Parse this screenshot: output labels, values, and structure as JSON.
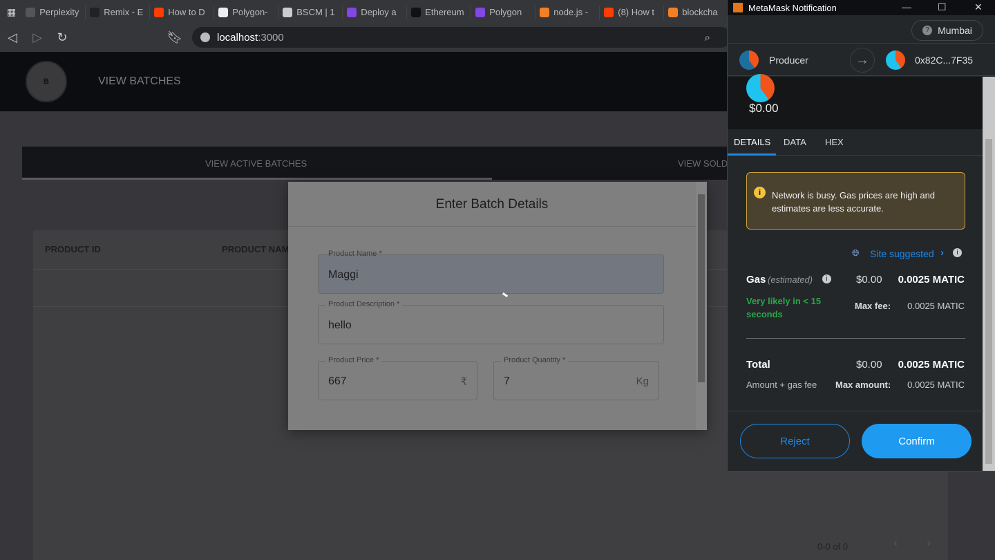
{
  "browser": {
    "tabs": [
      {
        "label": "Perplexity",
        "color": "#555"
      },
      {
        "label": "Remix - E",
        "color": "#222"
      },
      {
        "label": "How to D",
        "color": "#ff3d00"
      },
      {
        "label": "Polygon-",
        "color": "#eee"
      },
      {
        "label": "BSCM | 1",
        "color": "#ccc"
      },
      {
        "label": "Deploy a",
        "color": "#8247e5"
      },
      {
        "label": "Ethereum",
        "color": "#111"
      },
      {
        "label": "Polygon",
        "color": "#8247e5"
      },
      {
        "label": "node.js -",
        "color": "#f48024"
      },
      {
        "label": "(8) How t",
        "color": "#ff3d00"
      },
      {
        "label": "blockcha",
        "color": "#f48024"
      }
    ],
    "url_host": "localhost",
    "url_port": ":3000"
  },
  "app": {
    "logo_text": "B",
    "nav_link": "VIEW BATCHES",
    "tabs": [
      "VIEW ACTIVE BATCHES",
      "VIEW SOLD"
    ],
    "columns": [
      "PRODUCT ID",
      "PRODUCT NAM"
    ],
    "pagination": "0-0 of 0"
  },
  "modal": {
    "title": "Enter Batch Details",
    "fields": {
      "name": {
        "label": "Product Name *",
        "value": "Maggi"
      },
      "description": {
        "label": "Product Description *",
        "value": "hello"
      },
      "price": {
        "label": "Product Price *",
        "value": "667",
        "suffix": "₹"
      },
      "quantity": {
        "label": "Product Quantity *",
        "value": "7",
        "suffix": "Kg"
      }
    }
  },
  "metamask": {
    "title": "MetaMask Notification",
    "network": "Mumbai",
    "from": "Producer",
    "to": "0x82C...7F35",
    "amount": "$0.00",
    "tabs": [
      "DETAILS",
      "DATA",
      "HEX"
    ],
    "warning": "Network is busy. Gas prices are high and estimates are less accurate.",
    "site_suggested": "Site suggested",
    "gas_label": "Gas",
    "gas_estimated": "(estimated)",
    "gas_usd": "$0.00",
    "gas_matic": "0.0025 MATIC",
    "likely": "Very likely in < 15 seconds",
    "max_fee_label": "Max fee:",
    "max_fee": "0.0025 MATIC",
    "total_label": "Total",
    "total_usd": "$0.00",
    "total_matic": "0.0025 MATIC",
    "amount_gas": "Amount + gas fee",
    "max_amount_label": "Max amount:",
    "max_amount": "0.0025 MATIC",
    "reject": "Reject",
    "confirm": "Confirm",
    "accent": "#1e88e5",
    "warning_color": "#f5c33b",
    "success": "#28a745"
  }
}
